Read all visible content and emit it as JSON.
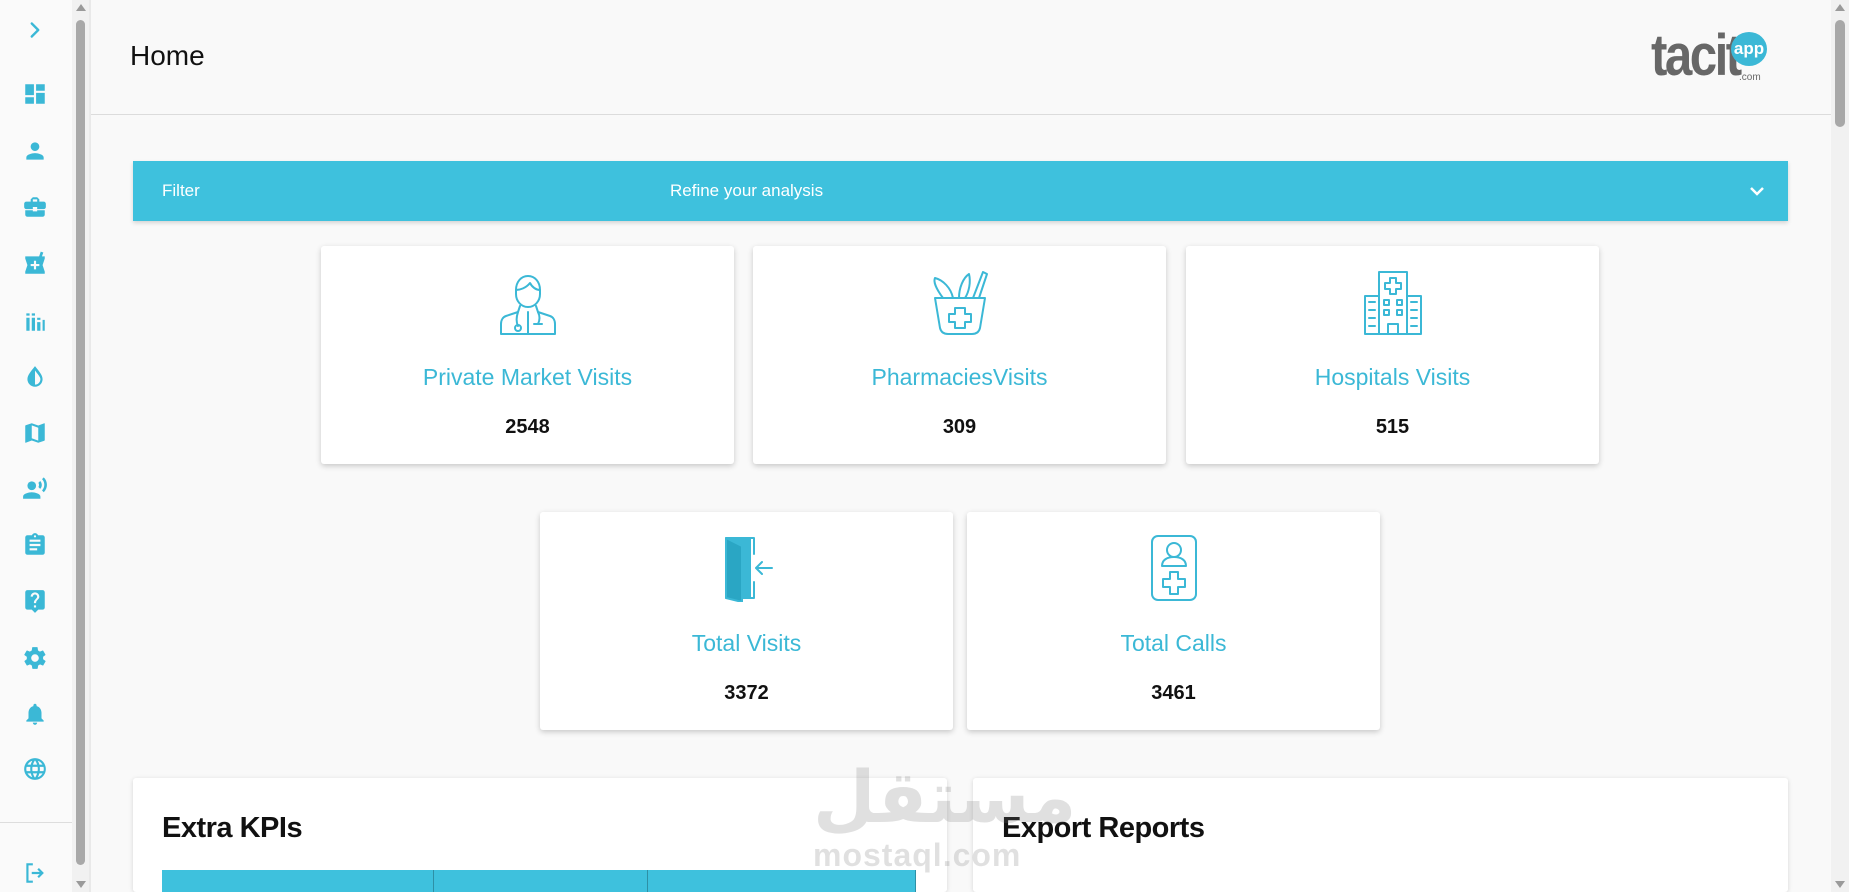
{
  "sidebar": {
    "toggle_icon": "chevron-right-icon",
    "items": [
      {
        "name": "dashboard-icon"
      },
      {
        "name": "person-icon"
      },
      {
        "name": "briefcase-icon"
      },
      {
        "name": "pharmacy-icon"
      },
      {
        "name": "bar-chart-icon"
      },
      {
        "name": "drop-icon"
      },
      {
        "name": "map-icon"
      },
      {
        "name": "call-person-icon"
      },
      {
        "name": "clipboard-icon"
      },
      {
        "name": "help-icon"
      },
      {
        "name": "settings-icon"
      },
      {
        "name": "bell-icon"
      },
      {
        "name": "globe-icon"
      }
    ],
    "logout_icon": "logout-icon"
  },
  "header": {
    "title": "Home",
    "logo": {
      "main": "tacit",
      "bubble": "app",
      "suffix": ".com"
    }
  },
  "filter": {
    "title": "Filter",
    "subtitle": "Refine your analysis"
  },
  "stats": [
    {
      "label": "Private Market Visits",
      "value": "2548",
      "icon": "doctor-icon"
    },
    {
      "label": "PharmaciesVisits",
      "value": "309",
      "icon": "pharmacy-basket-icon"
    },
    {
      "label": "Hospitals Visits",
      "value": "515",
      "icon": "hospital-icon"
    },
    {
      "label": "Total Visits",
      "value": "3372",
      "icon": "door-enter-icon"
    },
    {
      "label": "Total Calls",
      "value": "3461",
      "icon": "medical-id-icon"
    }
  ],
  "panels": {
    "kpis_title": "Extra KPIs",
    "export_title": "Export Reports"
  },
  "watermark": {
    "arabic": "مستقل",
    "latin": "mostaql.com"
  },
  "colors": {
    "accent": "#3ec1dd",
    "icon": "#3bb8d6",
    "text": "#111111",
    "background": "#f9f9f9"
  }
}
